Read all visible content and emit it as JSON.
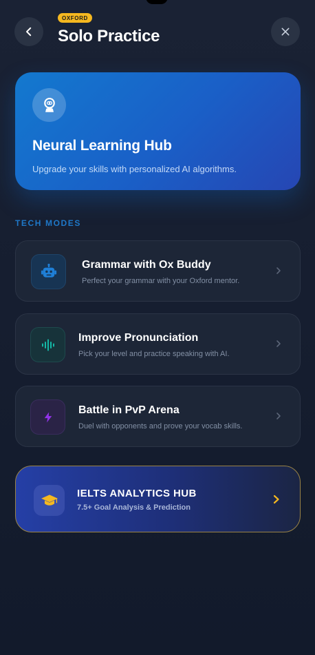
{
  "header": {
    "badge": "OXFORD",
    "title": "Solo Practice",
    "back_icon": "chevron-left-icon",
    "close_icon": "close-icon"
  },
  "hero": {
    "icon": "robot-astronaut-icon",
    "title": "Neural Learning Hub",
    "subtitle": "Upgrade your skills with personalized AI algorithms."
  },
  "section_label": "TECH MODES",
  "modes": [
    {
      "icon": "robot-icon",
      "title": "Grammar with Ox Buddy",
      "subtitle": "Perfect your grammar with your Oxford mentor.",
      "accent": "#1f7fd6"
    },
    {
      "icon": "sound-wave-icon",
      "title": "Improve Pronunciation",
      "subtitle": "Pick your level and practice speaking with AI.",
      "accent": "#14b8a6"
    },
    {
      "icon": "lightning-icon",
      "title": "Battle in PvP Arena",
      "subtitle": "Duel with opponents and prove your vocab skills.",
      "accent": "#9333ea"
    }
  ],
  "ielts": {
    "icon": "graduation-cap-icon",
    "title": "IELTS ANALYTICS HUB",
    "subtitle": "7.5+ Goal Analysis & Prediction",
    "accent": "#f5b820"
  }
}
